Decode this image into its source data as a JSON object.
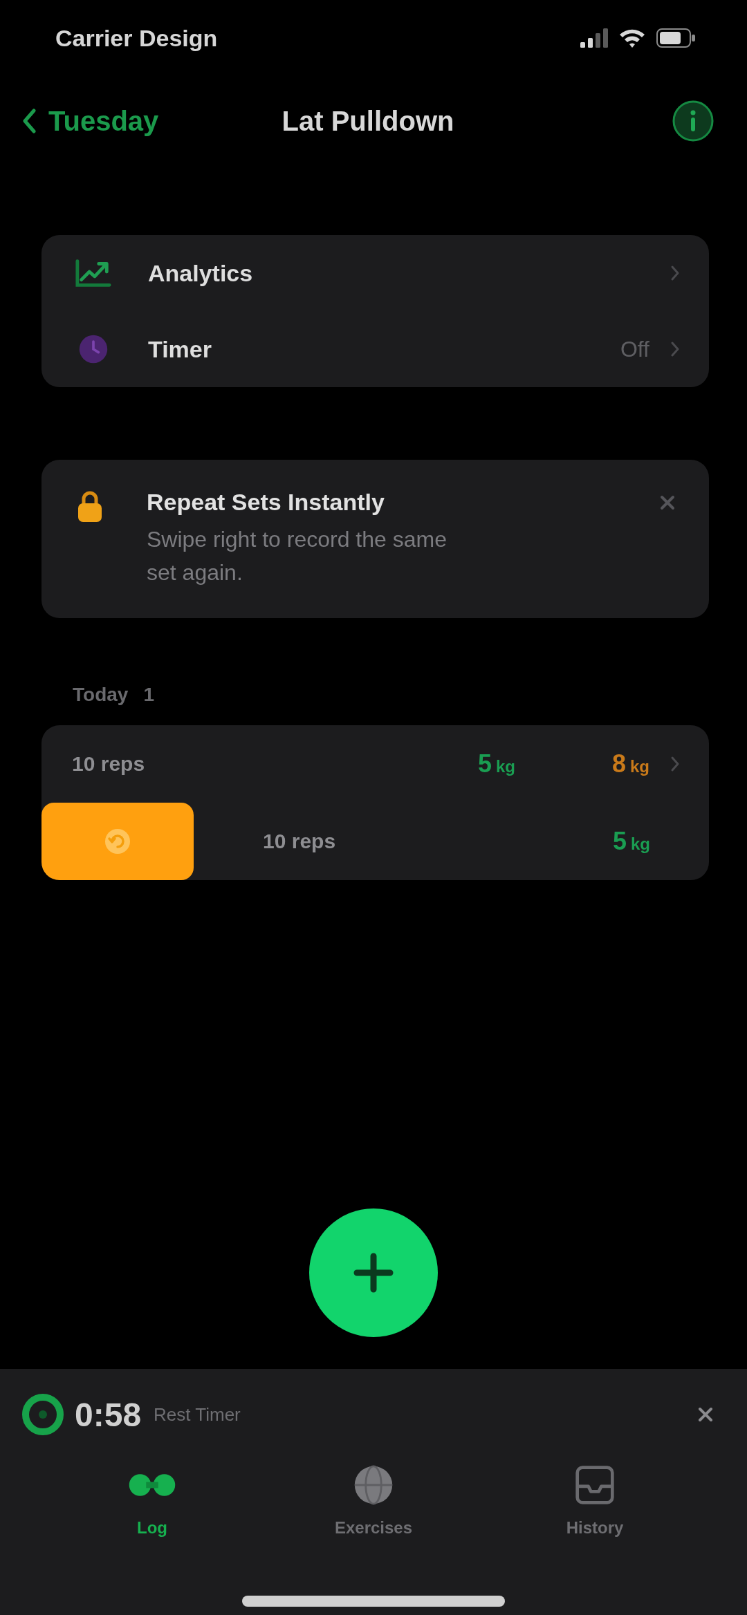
{
  "status_bar": {
    "carrier": "Carrier Design"
  },
  "nav": {
    "back": "Tuesday",
    "title": "Lat Pulldown"
  },
  "menu": [
    {
      "kind": "chart",
      "label": "Analytics"
    },
    {
      "kind": "clock",
      "label": "Timer",
      "value": "Off"
    }
  ],
  "tip": {
    "title": "Repeat Sets Instantly",
    "text": "Swipe right to record the same set again."
  },
  "section": {
    "title": "Today",
    "count": "1"
  },
  "sets": [
    {
      "label": "10 reps",
      "swiped": false,
      "values": [
        {
          "value": "5",
          "unit": "kg",
          "color": "#1a9e52"
        },
        {
          "value": "8",
          "unit": "kg",
          "color": "#c97a1a"
        }
      ]
    },
    {
      "label": "10 reps",
      "swiped": true,
      "values": [
        {
          "value": "5",
          "unit": "kg",
          "color": "#1a9e52"
        }
      ]
    }
  ],
  "rest_timer": {
    "time": "0:58",
    "label": "Rest Timer"
  },
  "tabs": [
    {
      "kind": "dumbbell",
      "label": "Log",
      "selected": true
    },
    {
      "kind": "globe",
      "label": "Exercises",
      "selected": false
    },
    {
      "kind": "tray",
      "label": "History",
      "selected": false
    }
  ]
}
